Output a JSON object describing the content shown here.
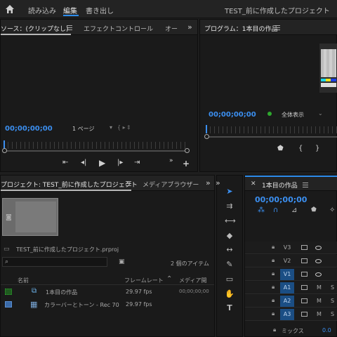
{
  "topbar": {
    "tabs": [
      {
        "label": "読み込み"
      },
      {
        "label": "編集"
      },
      {
        "label": "書き出し"
      }
    ],
    "project_title": "TEST_前に作成したプロジェクト"
  },
  "source_panel": {
    "tabs": [
      "ソース：(クリップなし)",
      "エフェクトコントロール",
      "オー"
    ],
    "timecode": "00;00;00;00",
    "page_select": "1 ページ"
  },
  "program_panel": {
    "title": "プログラム：1本目の作品",
    "timecode": "00;00;00;00",
    "fit_select": "全体表示"
  },
  "project_panel": {
    "tabs": [
      "プロジェクト: TEST_前に作成したプロジェクト",
      "メディアブラウザー"
    ],
    "filename": "TEST_前に作成したプロジェクト.prproj",
    "item_count": "2 個のアイテム",
    "columns": [
      "名前",
      "フレームレート",
      "メディア開"
    ],
    "rows": [
      {
        "name": "1本目の作品",
        "fps": "29.97 fps",
        "media": "00;00;00;00",
        "color": "#2ea82e"
      },
      {
        "name": "カラーバーとトーン - Rec 70",
        "fps": "29.97 fps",
        "media": "",
        "color": "#5b8fd1"
      }
    ]
  },
  "timeline": {
    "title": "1本目の作品",
    "timecode": "00;00;00;00",
    "tracks": [
      {
        "name": "V3",
        "targeted": false,
        "kind": "video"
      },
      {
        "name": "V2",
        "targeted": false,
        "kind": "video"
      },
      {
        "name": "V1",
        "targeted": true,
        "kind": "video"
      },
      {
        "name": "A1",
        "targeted": true,
        "kind": "audio"
      },
      {
        "name": "A2",
        "targeted": true,
        "kind": "audio"
      },
      {
        "name": "A3",
        "targeted": true,
        "kind": "audio"
      }
    ],
    "mix_label": "ミックス",
    "mix_value": "0.0",
    "audio_m": "M",
    "audio_s": "S"
  },
  "colors": {
    "accent": "#2d8ceb",
    "timecode": "#3b8ff0",
    "track_target": "#1b4e84"
  }
}
